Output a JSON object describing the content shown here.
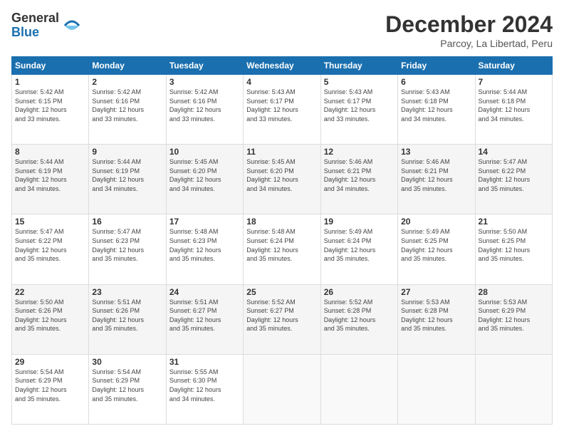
{
  "logo": {
    "general": "General",
    "blue": "Blue"
  },
  "title": "December 2024",
  "location": "Parcoy, La Libertad, Peru",
  "weekdays": [
    "Sunday",
    "Monday",
    "Tuesday",
    "Wednesday",
    "Thursday",
    "Friday",
    "Saturday"
  ],
  "weeks": [
    [
      {
        "day": "1",
        "sunrise": "5:42 AM",
        "sunset": "6:15 PM",
        "daylight": "12 hours and 33 minutes."
      },
      {
        "day": "2",
        "sunrise": "5:42 AM",
        "sunset": "6:16 PM",
        "daylight": "12 hours and 33 minutes."
      },
      {
        "day": "3",
        "sunrise": "5:42 AM",
        "sunset": "6:16 PM",
        "daylight": "12 hours and 33 minutes."
      },
      {
        "day": "4",
        "sunrise": "5:43 AM",
        "sunset": "6:17 PM",
        "daylight": "12 hours and 33 minutes."
      },
      {
        "day": "5",
        "sunrise": "5:43 AM",
        "sunset": "6:17 PM",
        "daylight": "12 hours and 33 minutes."
      },
      {
        "day": "6",
        "sunrise": "5:43 AM",
        "sunset": "6:18 PM",
        "daylight": "12 hours and 34 minutes."
      },
      {
        "day": "7",
        "sunrise": "5:44 AM",
        "sunset": "6:18 PM",
        "daylight": "12 hours and 34 minutes."
      }
    ],
    [
      {
        "day": "8",
        "sunrise": "5:44 AM",
        "sunset": "6:19 PM",
        "daylight": "12 hours and 34 minutes."
      },
      {
        "day": "9",
        "sunrise": "5:44 AM",
        "sunset": "6:19 PM",
        "daylight": "12 hours and 34 minutes."
      },
      {
        "day": "10",
        "sunrise": "5:45 AM",
        "sunset": "6:20 PM",
        "daylight": "12 hours and 34 minutes."
      },
      {
        "day": "11",
        "sunrise": "5:45 AM",
        "sunset": "6:20 PM",
        "daylight": "12 hours and 34 minutes."
      },
      {
        "day": "12",
        "sunrise": "5:46 AM",
        "sunset": "6:21 PM",
        "daylight": "12 hours and 34 minutes."
      },
      {
        "day": "13",
        "sunrise": "5:46 AM",
        "sunset": "6:21 PM",
        "daylight": "12 hours and 35 minutes."
      },
      {
        "day": "14",
        "sunrise": "5:47 AM",
        "sunset": "6:22 PM",
        "daylight": "12 hours and 35 minutes."
      }
    ],
    [
      {
        "day": "15",
        "sunrise": "5:47 AM",
        "sunset": "6:22 PM",
        "daylight": "12 hours and 35 minutes."
      },
      {
        "day": "16",
        "sunrise": "5:47 AM",
        "sunset": "6:23 PM",
        "daylight": "12 hours and 35 minutes."
      },
      {
        "day": "17",
        "sunrise": "5:48 AM",
        "sunset": "6:23 PM",
        "daylight": "12 hours and 35 minutes."
      },
      {
        "day": "18",
        "sunrise": "5:48 AM",
        "sunset": "6:24 PM",
        "daylight": "12 hours and 35 minutes."
      },
      {
        "day": "19",
        "sunrise": "5:49 AM",
        "sunset": "6:24 PM",
        "daylight": "12 hours and 35 minutes."
      },
      {
        "day": "20",
        "sunrise": "5:49 AM",
        "sunset": "6:25 PM",
        "daylight": "12 hours and 35 minutes."
      },
      {
        "day": "21",
        "sunrise": "5:50 AM",
        "sunset": "6:25 PM",
        "daylight": "12 hours and 35 minutes."
      }
    ],
    [
      {
        "day": "22",
        "sunrise": "5:50 AM",
        "sunset": "6:26 PM",
        "daylight": "12 hours and 35 minutes."
      },
      {
        "day": "23",
        "sunrise": "5:51 AM",
        "sunset": "6:26 PM",
        "daylight": "12 hours and 35 minutes."
      },
      {
        "day": "24",
        "sunrise": "5:51 AM",
        "sunset": "6:27 PM",
        "daylight": "12 hours and 35 minutes."
      },
      {
        "day": "25",
        "sunrise": "5:52 AM",
        "sunset": "6:27 PM",
        "daylight": "12 hours and 35 minutes."
      },
      {
        "day": "26",
        "sunrise": "5:52 AM",
        "sunset": "6:28 PM",
        "daylight": "12 hours and 35 minutes."
      },
      {
        "day": "27",
        "sunrise": "5:53 AM",
        "sunset": "6:28 PM",
        "daylight": "12 hours and 35 minutes."
      },
      {
        "day": "28",
        "sunrise": "5:53 AM",
        "sunset": "6:29 PM",
        "daylight": "12 hours and 35 minutes."
      }
    ],
    [
      {
        "day": "29",
        "sunrise": "5:54 AM",
        "sunset": "6:29 PM",
        "daylight": "12 hours and 35 minutes."
      },
      {
        "day": "30",
        "sunrise": "5:54 AM",
        "sunset": "6:29 PM",
        "daylight": "12 hours and 35 minutes."
      },
      {
        "day": "31",
        "sunrise": "5:55 AM",
        "sunset": "6:30 PM",
        "daylight": "12 hours and 34 minutes."
      },
      null,
      null,
      null,
      null
    ]
  ],
  "labels": {
    "sunrise": "Sunrise:",
    "sunset": "Sunset:",
    "daylight": "Daylight:"
  }
}
